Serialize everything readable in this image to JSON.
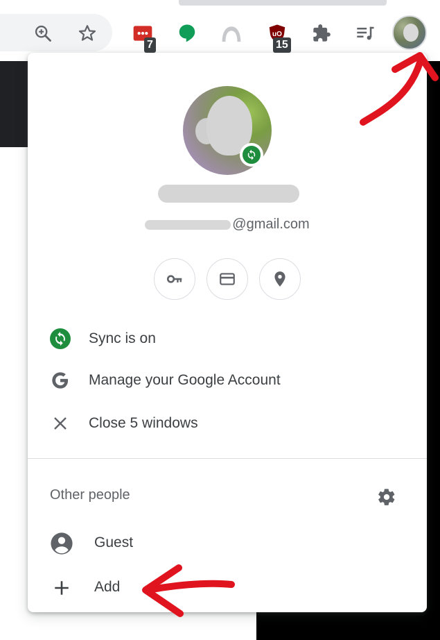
{
  "toolbar": {
    "icons": [
      "zoom-icon",
      "star-icon",
      "lastpass-extension-icon",
      "hangouts-extension-icon",
      "arc-extension-icon",
      "ublock-extension-icon",
      "puzzle-icon",
      "media-playlist-icon"
    ],
    "lastpass_badge": "7",
    "ublock_badge": "15"
  },
  "profile": {
    "email_visible": "@gmail.com"
  },
  "menu": {
    "sync_label": "Sync is on",
    "manage_label": "Manage your Google Account",
    "close_label": "Close 5 windows"
  },
  "other_people": {
    "title": "Other people",
    "guest_label": "Guest",
    "add_label": "Add"
  },
  "colors": {
    "sync_green": "#1e8e3e",
    "icon_gray": "#5f6368",
    "annotation_red": "#e0141e",
    "lastpass_red": "#d32d27",
    "hangouts_green": "#0f9d58",
    "ublock_red": "#800000"
  }
}
